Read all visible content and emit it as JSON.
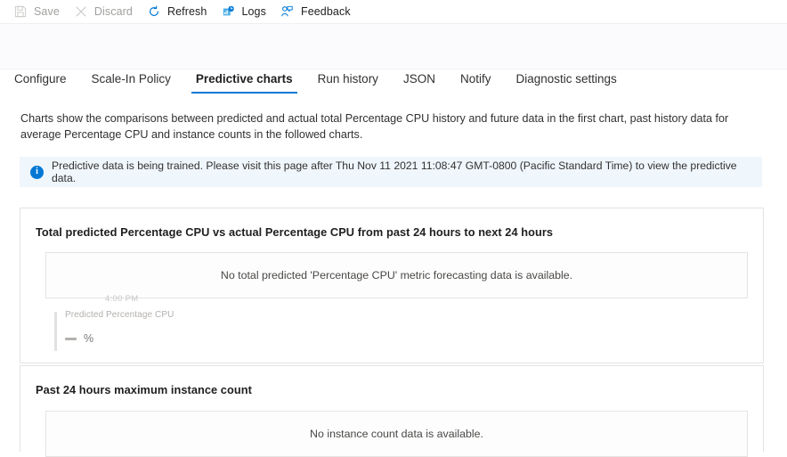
{
  "commandbar": {
    "items": [
      {
        "label": "Save",
        "icon": "save-icon",
        "disabled": true
      },
      {
        "label": "Discard",
        "icon": "discard-icon",
        "disabled": true
      },
      {
        "label": "Refresh",
        "icon": "refresh-icon",
        "disabled": false
      },
      {
        "label": "Logs",
        "icon": "logs-icon",
        "disabled": false
      },
      {
        "label": "Feedback",
        "icon": "feedback-icon",
        "disabled": false
      }
    ]
  },
  "tabs": [
    {
      "label": "Configure",
      "active": false
    },
    {
      "label": "Scale-In Policy",
      "active": false
    },
    {
      "label": "Predictive charts",
      "active": true
    },
    {
      "label": "Run history",
      "active": false
    },
    {
      "label": "JSON",
      "active": false
    },
    {
      "label": "Notify",
      "active": false
    },
    {
      "label": "Diagnostic settings",
      "active": false
    }
  ],
  "description": "Charts show the comparisons between predicted and actual total Percentage CPU history and future data in the first chart, past history data for average Percentage CPU and instance counts in the followed charts.",
  "info_banner": {
    "icon": "info-icon",
    "glyph": "i",
    "text": "Predictive data is being trained. Please visit this page after Thu Nov 11 2021 11:08:47 GMT-0800 (Pacific Standard Time) to view the predictive data."
  },
  "cards": {
    "forecast": {
      "title": "Total predicted Percentage CPU vs actual Percentage CPU from past 24 hours to next 24 hours",
      "empty_message": "No total predicted 'Percentage CPU' metric forecasting data is available.",
      "ghost": {
        "x_tick": "4:00 PM",
        "legend_title": "Predicted Percentage CPU",
        "legend_unit": "%"
      }
    },
    "instance": {
      "title": "Past 24 hours maximum instance count",
      "empty_message": "No instance count data is available."
    }
  },
  "colors": {
    "accent": "#0078d4",
    "info_bg": "#eff6fc",
    "text": "#323130",
    "disabled_text": "#a19f9d",
    "card_border": "#e6e4e2"
  }
}
